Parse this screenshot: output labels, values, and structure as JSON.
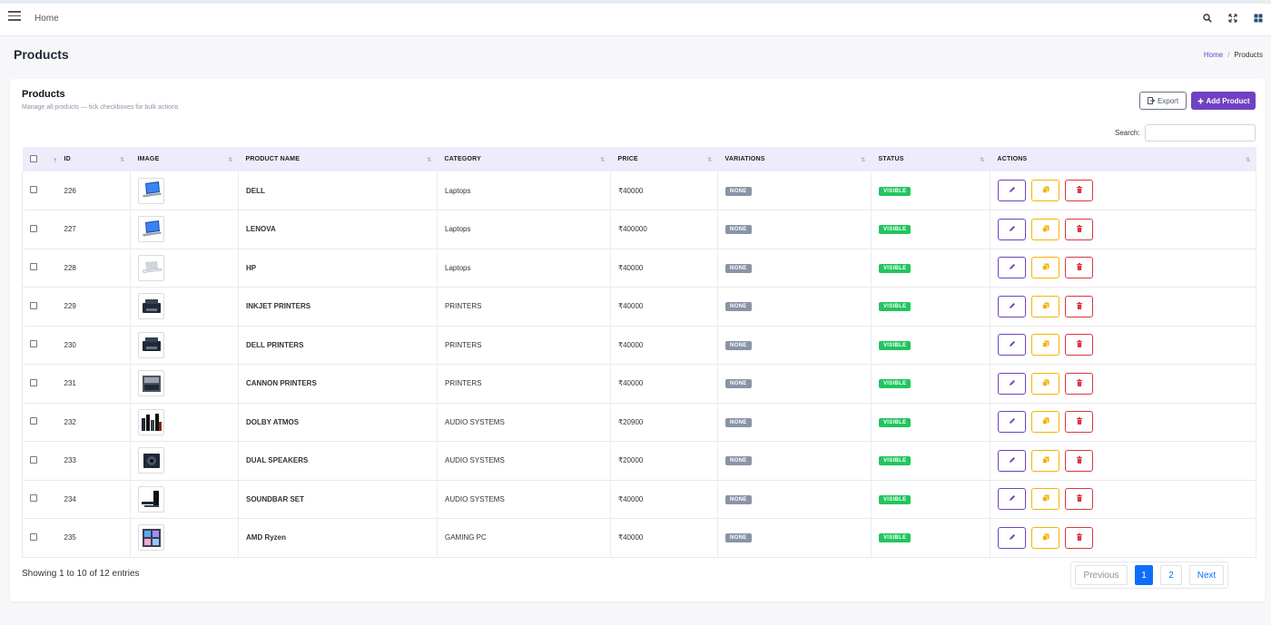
{
  "topnav": {
    "home_label": "Home",
    "icons": [
      "menu-icon",
      "search-icon",
      "fullscreen-icon",
      "apps-grid-icon"
    ]
  },
  "page": {
    "title": "Products",
    "breadcrumb": {
      "home": "Home",
      "separator": "/",
      "current": "Products"
    }
  },
  "card": {
    "title": "Products",
    "subtitle": "Manage all products — tick checkboxes for bulk actions",
    "export_label": "Export",
    "add_label": "Add Product",
    "search_label": "Search:",
    "search_value": ""
  },
  "table": {
    "headers": {
      "id": "ID",
      "image": "IMAGE",
      "name": "PRODUCT NAME",
      "category": "CATEGORY",
      "price": "PRICE",
      "variations": "VARIATIONS",
      "status": "STATUS",
      "actions": "ACTIONS"
    },
    "rows": [
      {
        "id": "226",
        "image": "laptop",
        "name": "DELL",
        "category": "Laptops",
        "price": "₹40000",
        "variations": "NONE",
        "status": "VISIBLE"
      },
      {
        "id": "227",
        "image": "laptop",
        "name": "LENOVA",
        "category": "Laptops",
        "price": "₹400000",
        "variations": "NONE",
        "status": "VISIBLE"
      },
      {
        "id": "228",
        "image": "laptop-silver",
        "name": "HP",
        "category": "Laptops",
        "price": "₹40000",
        "variations": "NONE",
        "status": "VISIBLE"
      },
      {
        "id": "229",
        "image": "printer",
        "name": "INKJET PRINTERS",
        "category": "PRINTERS",
        "price": "₹40000",
        "variations": "NONE",
        "status": "VISIBLE"
      },
      {
        "id": "230",
        "image": "printer",
        "name": "DELL PRINTERS",
        "category": "PRINTERS",
        "price": "₹40000",
        "variations": "NONE",
        "status": "VISIBLE"
      },
      {
        "id": "231",
        "image": "printer-large",
        "name": "CANNON PRINTERS",
        "category": "PRINTERS",
        "price": "₹40000",
        "variations": "NONE",
        "status": "VISIBLE"
      },
      {
        "id": "232",
        "image": "speakers",
        "name": "DOLBY ATMOS",
        "category": "AUDIO SYSTEMS",
        "price": "₹20900",
        "variations": "NONE",
        "status": "VISIBLE"
      },
      {
        "id": "233",
        "image": "speaker-pair",
        "name": "DUAL SPEAKERS",
        "category": "AUDIO SYSTEMS",
        "price": "₹20000",
        "variations": "NONE",
        "status": "VISIBLE"
      },
      {
        "id": "234",
        "image": "soundbar",
        "name": "SOUNDBAR SET",
        "category": "AUDIO SYSTEMS",
        "price": "₹40000",
        "variations": "NONE",
        "status": "VISIBLE"
      },
      {
        "id": "235",
        "image": "gaming-pc",
        "name": "AMD Ryzen",
        "category": "GAMING PC",
        "price": "₹40000",
        "variations": "NONE",
        "status": "VISIBLE"
      }
    ]
  },
  "footer": {
    "entries_info": "Showing 1 to 10 of 12 entries",
    "pagination": {
      "previous": "Previous",
      "pages": [
        "1",
        "2"
      ],
      "current": "1",
      "next": "Next"
    }
  },
  "colors": {
    "accent": "#6f42c1",
    "header_bg": "#eeebfa",
    "badge_none": "#8a94a6",
    "badge_visible": "#22c55e",
    "copy_border": "#f5b301",
    "delete_border": "#dc3545",
    "pagination_active": "#0d6efd"
  }
}
